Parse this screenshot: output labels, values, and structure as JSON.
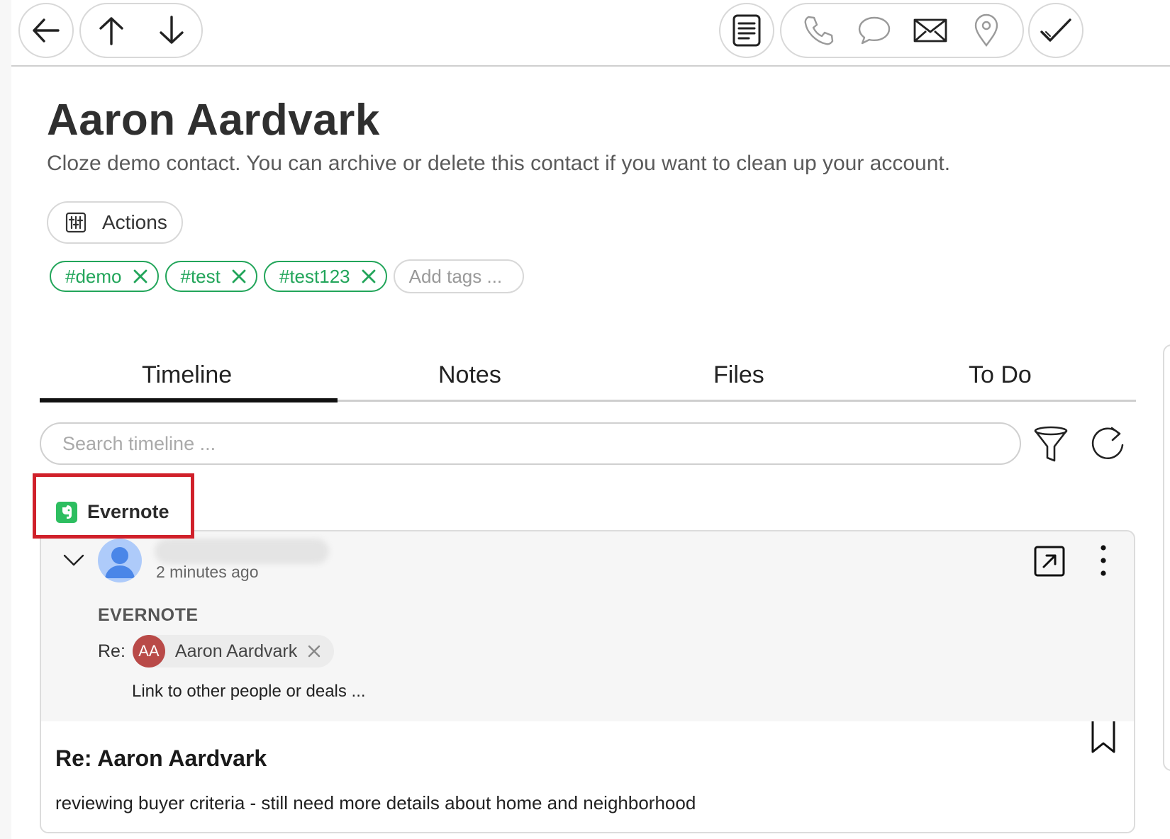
{
  "contact": {
    "name": "Aaron Aardvark",
    "description": "Cloze demo contact. You can archive or delete this contact if you want to clean up your account."
  },
  "actions": {
    "label": "Actions"
  },
  "tags": {
    "items": [
      "#demo",
      "#test",
      "#test123"
    ],
    "add_placeholder": "Add tags ..."
  },
  "tabs": [
    {
      "label": "Timeline",
      "active": true
    },
    {
      "label": "Notes",
      "active": false
    },
    {
      "label": "Files",
      "active": false
    },
    {
      "label": "To Do",
      "active": false
    }
  ],
  "search": {
    "placeholder": "Search timeline ..."
  },
  "source": {
    "name": "Evernote"
  },
  "entry": {
    "time": "2 minutes ago",
    "kind": "EVERNOTE",
    "re_label": "Re:",
    "person": {
      "initials": "AA",
      "name": "Aaron Aardvark"
    },
    "link_prompt": "Link to other people or deals ...",
    "title": "Re: Aaron Aardvark",
    "text": "reviewing buyer criteria - still need more details about home and neighborhood"
  },
  "colors": {
    "tag_green": "#22a55a",
    "highlight_red": "#d0202a",
    "avatar_red": "#b94a48",
    "avatar_blue": "#4a86e8"
  }
}
